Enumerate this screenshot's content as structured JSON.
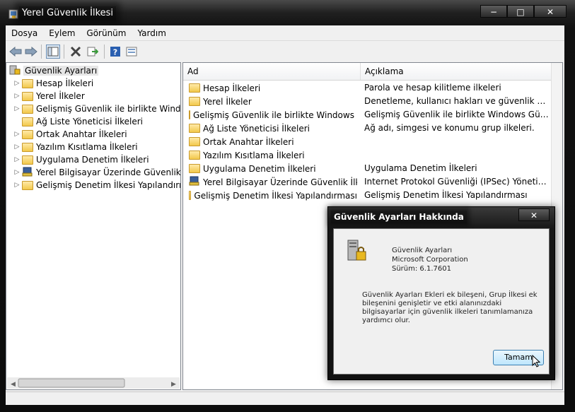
{
  "window": {
    "title": "Yerel Güvenlik İlkesi",
    "caption_min": "−",
    "caption_max": "□",
    "caption_close": "✕"
  },
  "menu": [
    "Dosya",
    "Eylem",
    "Görünüm",
    "Yardım"
  ],
  "tree": {
    "root": "Güvenlik Ayarları",
    "items": [
      {
        "label": "Hesap İlkeleri",
        "expander": "▷"
      },
      {
        "label": "Yerel İlkeler",
        "expander": "▷"
      },
      {
        "label": "Gelişmiş Güvenlik ile birlikte Windows",
        "expander": "▷"
      },
      {
        "label": "Ağ Liste Yöneticisi İlkeleri",
        "expander": ""
      },
      {
        "label": "Ortak Anahtar İlkeleri",
        "expander": "▷"
      },
      {
        "label": "Yazılım Kısıtlama İlkeleri",
        "expander": "▷"
      },
      {
        "label": "Uygulama Denetim İlkeleri",
        "expander": "▷"
      },
      {
        "label": "Yerel Bilgisayar Üzerinde Güvenlik İlke",
        "expander": "▷"
      },
      {
        "label": "Gelişmiş Denetim İlkesi Yapılandırması",
        "expander": "▷"
      }
    ]
  },
  "list": {
    "columns": [
      "Ad",
      "Açıklama"
    ],
    "rows": [
      {
        "name": "Hesap İlkeleri",
        "desc": "Parola ve hesap kilitleme ilkeleri"
      },
      {
        "name": "Yerel İlkeler",
        "desc": "Denetleme, kullanıcı hakları ve güvenlik seçene..."
      },
      {
        "name": "Gelişmiş Güvenlik ile birlikte Windows G...",
        "desc": "Gelişmiş Güvenlik ile birlikte Windows Güvenlik..."
      },
      {
        "name": "Ağ Liste Yöneticisi İlkeleri",
        "desc": "Ağ adı, simgesi ve konumu grup ilkeleri."
      },
      {
        "name": "Ortak Anahtar İlkeleri",
        "desc": ""
      },
      {
        "name": "Yazılım Kısıtlama İlkeleri",
        "desc": ""
      },
      {
        "name": "Uygulama Denetim İlkeleri",
        "desc": "Uygulama Denetim İlkeleri"
      },
      {
        "name": "Yerel Bilgisayar Üzerinde Güvenlik İlkeleri",
        "desc": "Internet Protokol Güvenliği (IPSec) Yönetimi. D..."
      },
      {
        "name": "Gelişmiş Denetim İlkesi Yapılandırması",
        "desc": "Gelişmiş Denetim İlkesi Yapılandırması"
      }
    ]
  },
  "dialog": {
    "title": "Güvenlik Ayarları Hakkında",
    "close": "✕",
    "product": "Güvenlik Ayarları",
    "company": "Microsoft Corporation",
    "version": "Sürüm: 6.1.7601",
    "description": "Güvenlik Ayarları Ekleri ek bileşeni, Grup İlkesi ek bileşenini genişletir ve etki alanınızdaki bilgisayarlar için güvenlik ilkeleri tanımlamanıza yardımcı olur.",
    "ok_label": "Tamam"
  }
}
